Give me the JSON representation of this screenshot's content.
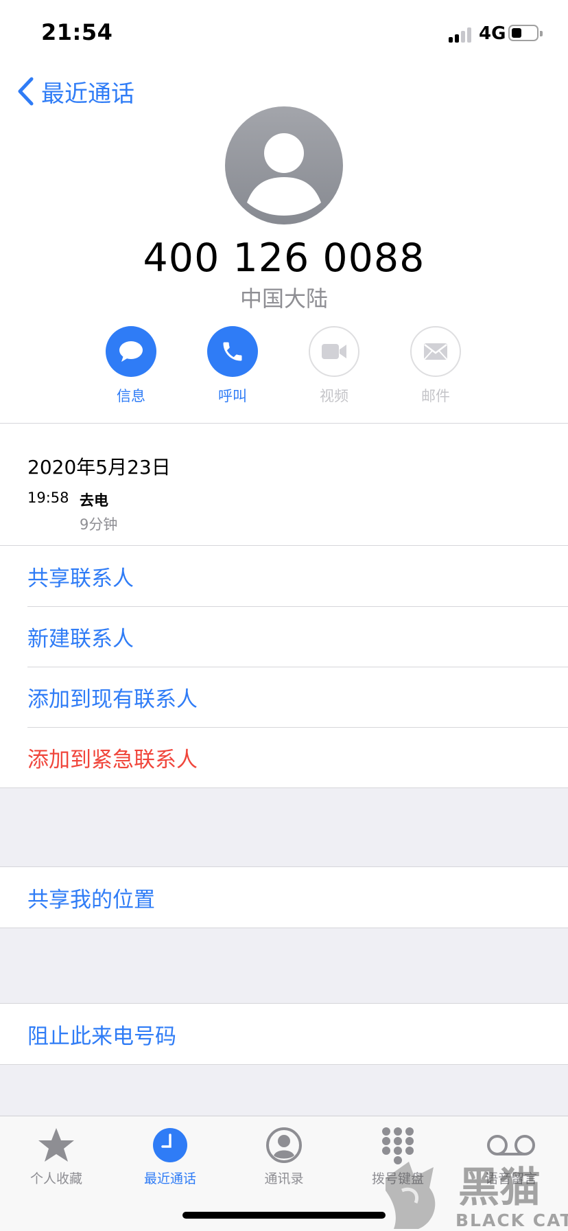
{
  "status_bar": {
    "time": "21:54",
    "network": "4G",
    "battery_level": 0.4
  },
  "nav": {
    "back_label": "最近通话"
  },
  "contact": {
    "number": "400 126 0088",
    "region": "中国大陆"
  },
  "actions": [
    {
      "label": "信息",
      "icon": "message-icon",
      "enabled": true
    },
    {
      "label": "呼叫",
      "icon": "phone-icon",
      "enabled": true
    },
    {
      "label": "视频",
      "icon": "video-icon",
      "enabled": false
    },
    {
      "label": "邮件",
      "icon": "mail-icon",
      "enabled": false
    }
  ],
  "call_log": {
    "date": "2020年5月23日",
    "time": "19:58",
    "type": "去电",
    "duration": "9分钟"
  },
  "contact_actions": [
    "共享联系人",
    "新建联系人",
    "添加到现有联系人",
    "添加到紧急联系人"
  ],
  "share_location": "共享我的位置",
  "block_caller": "阻止此来电号码",
  "tabs": [
    {
      "label": "个人收藏",
      "icon": "star-icon",
      "active": false
    },
    {
      "label": "最近通话",
      "icon": "clock-icon",
      "active": true
    },
    {
      "label": "通讯录",
      "icon": "contacts-icon",
      "active": false
    },
    {
      "label": "拨号键盘",
      "icon": "keypad-icon",
      "active": false
    },
    {
      "label": "语音留言",
      "icon": "voicemail-icon",
      "active": false
    }
  ],
  "colors": {
    "accent": "#2f7cf6",
    "destructive": "#f0463b"
  },
  "watermark": {
    "text": "黑猫",
    "subtext": "BLACK CAT"
  }
}
